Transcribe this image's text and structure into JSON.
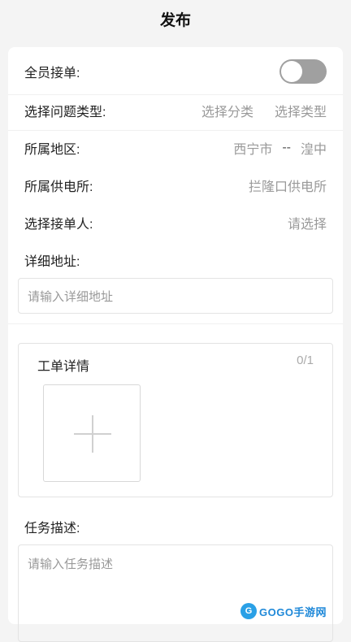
{
  "header": {
    "title": "发布"
  },
  "form": {
    "all_staff": {
      "label": "全员接单:",
      "toggle_on": false
    },
    "problem_type": {
      "label": "选择问题类型:",
      "category_placeholder": "选择分类",
      "type_placeholder": "选择类型"
    },
    "region": {
      "label": "所属地区:",
      "city": "西宁市",
      "separator": "--",
      "district": "湟中"
    },
    "power_station": {
      "label": "所属供电所:",
      "value": "拦隆口供电所"
    },
    "receiver": {
      "label": "选择接单人:",
      "placeholder": "请选择"
    },
    "address": {
      "label": "详细地址:",
      "placeholder": "请输入详细地址"
    },
    "work_order": {
      "title": "工单详情",
      "count": "0/1"
    },
    "task": {
      "label": "任务描述:",
      "placeholder": "请输入任务描述"
    }
  },
  "watermark": {
    "logo": "G",
    "text": "GOGO手游网"
  },
  "colors": {
    "toggle_off": "#a0a0a0",
    "placeholder": "#999999",
    "watermark": "#1e88d8"
  }
}
